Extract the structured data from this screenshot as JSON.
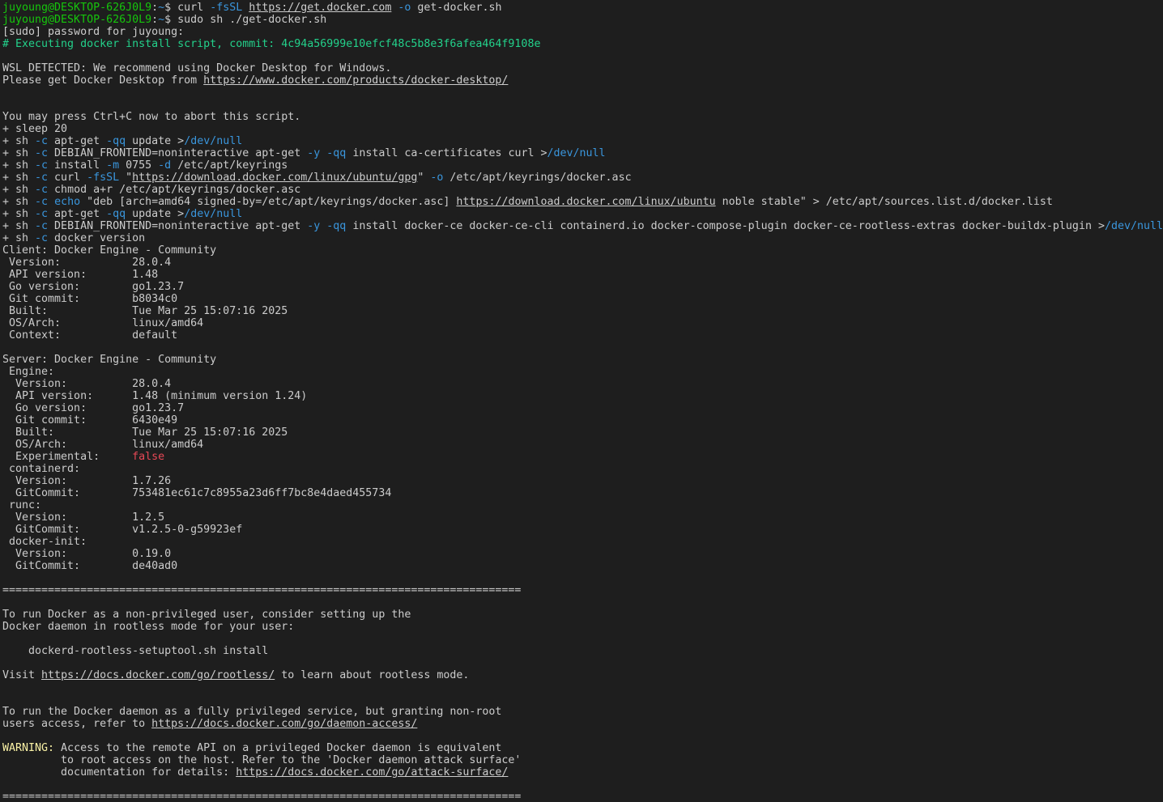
{
  "window": {
    "title": "juyoung@DESKTOP-626J0L9: ~"
  },
  "colors": {
    "background": "#1e1e1e",
    "text": "#cccccc",
    "prompt_user": "#16c60c",
    "prompt_path": "#3b78ff",
    "option_flag": "#3a96dd",
    "comment": "#23d18b",
    "false_value": "#e74856",
    "warning": "#f9f1a5"
  },
  "terminal": {
    "lines": [
      [
        {
          "t": "juyoung@DESKTOP-626J0L9",
          "c": "green"
        },
        {
          "t": ":"
        },
        {
          "t": "~",
          "c": "cyan"
        },
        {
          "t": "$ curl "
        },
        {
          "t": "-fsSL",
          "c": "cyan"
        },
        {
          "t": " "
        },
        {
          "t": "https://get.docker.com",
          "u": true
        },
        {
          "t": " "
        },
        {
          "t": "-o",
          "c": "cyan"
        },
        {
          "t": " get-docker.sh"
        }
      ],
      [
        {
          "t": "juyoung@DESKTOP-626J0L9",
          "c": "green"
        },
        {
          "t": ":"
        },
        {
          "t": "~",
          "c": "cyan"
        },
        {
          "t": "$ sudo sh ./get-docker.sh"
        }
      ],
      [
        {
          "t": "[sudo] password for juyoung:"
        }
      ],
      [
        {
          "t": "# Executing docker install script, commit: 4c94a56999e10efcf48c5b8e3f6afea464f9108e",
          "c": "hash"
        }
      ],
      [
        {
          "t": ""
        }
      ],
      [
        {
          "t": "WSL DETECTED: We recommend using Docker Desktop for Windows."
        }
      ],
      [
        {
          "t": "Please get Docker Desktop from "
        },
        {
          "t": "https://www.docker.com/products/docker-desktop/",
          "u": true
        }
      ],
      [
        {
          "t": ""
        }
      ],
      [
        {
          "t": ""
        }
      ],
      [
        {
          "t": "You may press Ctrl+C now to abort this script."
        }
      ],
      [
        {
          "t": "+ sleep 20"
        }
      ],
      [
        {
          "t": "+ sh "
        },
        {
          "t": "-c",
          "c": "cyan"
        },
        {
          "t": " apt-get "
        },
        {
          "t": "-qq",
          "c": "cyan"
        },
        {
          "t": " update >"
        },
        {
          "t": "/dev/null",
          "c": "cyan"
        }
      ],
      [
        {
          "t": "+ sh "
        },
        {
          "t": "-c",
          "c": "cyan"
        },
        {
          "t": " DEBIAN_FRONTEND=noninteractive apt-get "
        },
        {
          "t": "-y",
          "c": "cyan"
        },
        {
          "t": " "
        },
        {
          "t": "-qq",
          "c": "cyan"
        },
        {
          "t": " install ca-certificates curl >"
        },
        {
          "t": "/dev/null",
          "c": "cyan"
        }
      ],
      [
        {
          "t": "+ sh "
        },
        {
          "t": "-c",
          "c": "cyan"
        },
        {
          "t": " install "
        },
        {
          "t": "-m",
          "c": "cyan"
        },
        {
          "t": " 0755 "
        },
        {
          "t": "-d",
          "c": "cyan"
        },
        {
          "t": " /etc/apt/keyrings"
        }
      ],
      [
        {
          "t": "+ sh "
        },
        {
          "t": "-c",
          "c": "cyan"
        },
        {
          "t": " curl "
        },
        {
          "t": "-fsSL",
          "c": "cyan"
        },
        {
          "t": " \""
        },
        {
          "t": "https://download.docker.com/linux/ubuntu/gpg",
          "u": true
        },
        {
          "t": "\" "
        },
        {
          "t": "-o",
          "c": "cyan"
        },
        {
          "t": " /etc/apt/keyrings/docker.asc"
        }
      ],
      [
        {
          "t": "+ sh "
        },
        {
          "t": "-c",
          "c": "cyan"
        },
        {
          "t": " chmod a+r /etc/apt/keyrings/docker.asc"
        }
      ],
      [
        {
          "t": "+ sh "
        },
        {
          "t": "-c",
          "c": "cyan"
        },
        {
          "t": " "
        },
        {
          "t": "echo",
          "c": "cyan"
        },
        {
          "t": " \"deb [arch=amd64 signed-by=/etc/apt/keyrings/docker.asc] "
        },
        {
          "t": "https://download.docker.com/linux/ubuntu",
          "u": true
        },
        {
          "t": " noble stable\" > /etc/apt/sources.list.d/docker.list"
        }
      ],
      [
        {
          "t": "+ sh "
        },
        {
          "t": "-c",
          "c": "cyan"
        },
        {
          "t": " apt-get "
        },
        {
          "t": "-qq",
          "c": "cyan"
        },
        {
          "t": " update >"
        },
        {
          "t": "/dev/null",
          "c": "cyan"
        }
      ],
      [
        {
          "t": "+ sh "
        },
        {
          "t": "-c",
          "c": "cyan"
        },
        {
          "t": " DEBIAN_FRONTEND=noninteractive apt-get "
        },
        {
          "t": "-y",
          "c": "cyan"
        },
        {
          "t": " "
        },
        {
          "t": "-qq",
          "c": "cyan"
        },
        {
          "t": " install docker-ce docker-ce-cli containerd.io docker-compose-plugin docker-ce-rootless-extras docker-buildx-plugin >"
        },
        {
          "t": "/dev/null",
          "c": "cyan"
        }
      ],
      [
        {
          "t": "+ sh "
        },
        {
          "t": "-c",
          "c": "cyan"
        },
        {
          "t": " docker version"
        }
      ],
      [
        {
          "t": "Client: Docker Engine - Community"
        }
      ],
      [
        {
          "t": " Version:           28.0.4"
        }
      ],
      [
        {
          "t": " API version:       1.48"
        }
      ],
      [
        {
          "t": " Go version:        go1.23.7"
        }
      ],
      [
        {
          "t": " Git commit:        b8034c0"
        }
      ],
      [
        {
          "t": " Built:             Tue Mar 25 15:07:16 2025"
        }
      ],
      [
        {
          "t": " OS/Arch:           linux/amd64"
        }
      ],
      [
        {
          "t": " Context:           default"
        }
      ],
      [
        {
          "t": ""
        }
      ],
      [
        {
          "t": "Server: Docker Engine - Community"
        }
      ],
      [
        {
          "t": " Engine:"
        }
      ],
      [
        {
          "t": "  Version:          28.0.4"
        }
      ],
      [
        {
          "t": "  API version:      1.48 (minimum version 1.24)"
        }
      ],
      [
        {
          "t": "  Go version:       go1.23.7"
        }
      ],
      [
        {
          "t": "  Git commit:       6430e49"
        }
      ],
      [
        {
          "t": "  Built:            Tue Mar 25 15:07:16 2025"
        }
      ],
      [
        {
          "t": "  OS/Arch:          linux/amd64"
        }
      ],
      [
        {
          "t": "  Experimental:     "
        },
        {
          "t": "false",
          "c": "red"
        }
      ],
      [
        {
          "t": " containerd:"
        }
      ],
      [
        {
          "t": "  Version:          1.7.26"
        }
      ],
      [
        {
          "t": "  GitCommit:        753481ec61c7c8955a23d6ff7bc8e4daed455734"
        }
      ],
      [
        {
          "t": " runc:"
        }
      ],
      [
        {
          "t": "  Version:          1.2.5"
        }
      ],
      [
        {
          "t": "  GitCommit:        v1.2.5-0-g59923ef"
        }
      ],
      [
        {
          "t": " docker-init:"
        }
      ],
      [
        {
          "t": "  Version:          0.19.0"
        }
      ],
      [
        {
          "t": "  GitCommit:        de40ad0"
        }
      ],
      [
        {
          "t": ""
        }
      ],
      [
        {
          "t": "================================================================================"
        }
      ],
      [
        {
          "t": ""
        }
      ],
      [
        {
          "t": "To run Docker as a non-privileged user, consider setting up the"
        }
      ],
      [
        {
          "t": "Docker daemon in rootless mode for your user:"
        }
      ],
      [
        {
          "t": ""
        }
      ],
      [
        {
          "t": "    dockerd-rootless-setuptool.sh install"
        }
      ],
      [
        {
          "t": ""
        }
      ],
      [
        {
          "t": "Visit "
        },
        {
          "t": "https://docs.docker.com/go/rootless/",
          "u": true
        },
        {
          "t": " to learn about rootless mode."
        }
      ],
      [
        {
          "t": ""
        }
      ],
      [
        {
          "t": ""
        }
      ],
      [
        {
          "t": "To run the Docker daemon as a fully privileged service, but granting non-root"
        }
      ],
      [
        {
          "t": "users access, refer to "
        },
        {
          "t": "https://docs.docker.com/go/daemon-access/",
          "u": true
        }
      ],
      [
        {
          "t": ""
        }
      ],
      [
        {
          "t": "WARNING:",
          "c": "yellow"
        },
        {
          "t": " Access to the remote API on a privileged Docker daemon is equivalent"
        }
      ],
      [
        {
          "t": "         to root access on the host. Refer to the 'Docker daemon attack surface'"
        }
      ],
      [
        {
          "t": "         documentation for details: "
        },
        {
          "t": "https://docs.docker.com/go/attack-surface/",
          "u": true
        }
      ],
      [
        {
          "t": ""
        }
      ],
      [
        {
          "t": "================================================================================"
        }
      ]
    ]
  }
}
